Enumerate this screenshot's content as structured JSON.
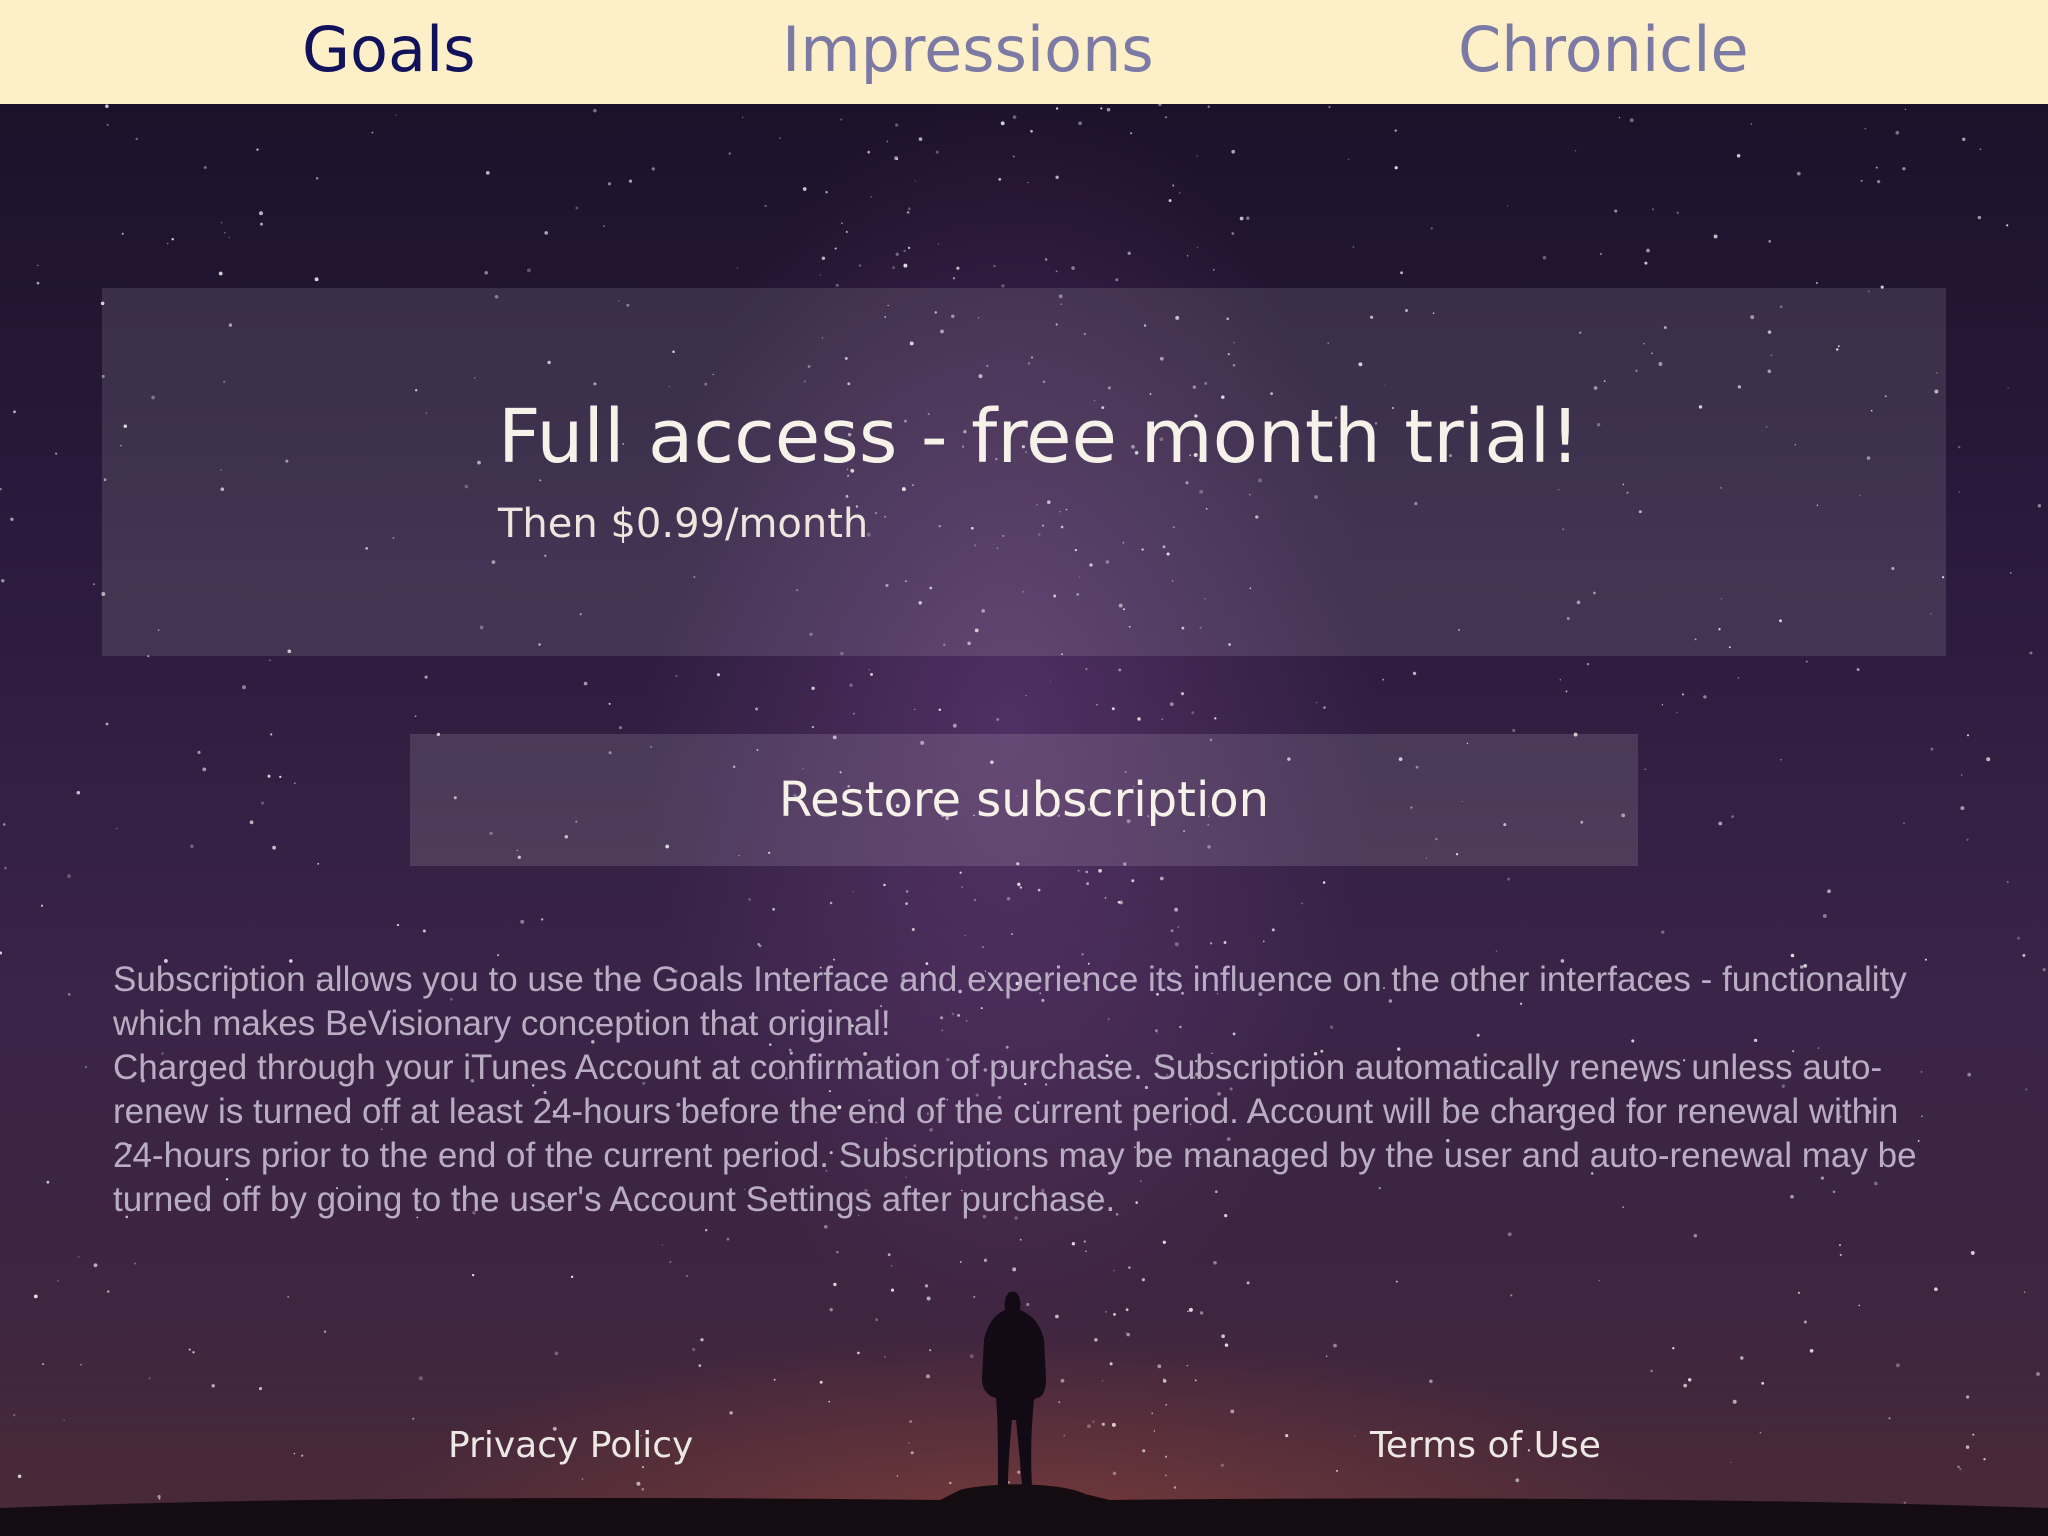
{
  "tabs": [
    {
      "label": "Goals",
      "active": true
    },
    {
      "label": "Impressions",
      "active": false
    },
    {
      "label": "Chronicle",
      "active": false
    }
  ],
  "offer": {
    "title": "Full access - free month trial!",
    "subtitle": "Then $0.99/month"
  },
  "restore": {
    "label": "Restore subscription"
  },
  "legal": {
    "paragraph1": "Subscription allows you to use the Goals Interface and experience its influence on the other interfaces - functionality which makes BeVisionary conception that original!",
    "paragraph2": "Charged through your iTunes Account at confirmation of purchase. Subscription automatically renews unless auto-renew is turned off at least 24-hours before the end of the current period. Account will be charged for renewal within 24-hours prior to the end of the current period. Subscriptions may be managed by the user and auto-renewal may be turned off by going to the user's Account Settings after purchase."
  },
  "footer": {
    "privacy_label": "Privacy Policy",
    "terms_label": "Terms of Use"
  },
  "colors": {
    "tabbar_bg": "#fdf0c9",
    "tab_active": "#12125c",
    "tab_inactive": "#7c7aa4"
  }
}
